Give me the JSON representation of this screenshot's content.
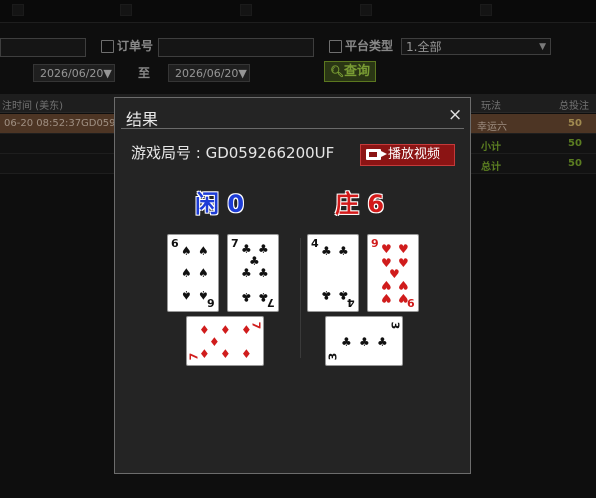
{
  "filters": {
    "order_no_label": "订单号",
    "order_no_value": "",
    "platform_label": "平台类型",
    "platform_value": "1.全部",
    "date_from": "2026/06/20▼",
    "to_label": "至",
    "date_to": "2026/06/20▼",
    "query_label": "查询"
  },
  "table": {
    "headers": {
      "bet_time": "注时间 (美东)",
      "play": "玩法",
      "total_bet": "总投注"
    },
    "rows": [
      {
        "bet_time": "06-20 08:52:37",
        "order": "GD059",
        "play": "幸运六",
        "total_bet": "50"
      },
      {
        "bet_time": "",
        "order": "",
        "play": "小计",
        "total_bet": "50"
      },
      {
        "bet_time": "",
        "order": "",
        "play": "总计",
        "total_bet": "50"
      }
    ]
  },
  "modal": {
    "title": "结果",
    "close": "×",
    "game_label": "游戏局号 : GD059266200UF",
    "video_button": "播放视频",
    "player_title": "闲 0",
    "banker_title": "庄 6",
    "player_cards": [
      {
        "rank": "6",
        "suit": "♠"
      },
      {
        "rank": "7",
        "suit": "♣"
      },
      {
        "rank": "7",
        "suit": "♦"
      }
    ],
    "banker_cards": [
      {
        "rank": "4",
        "suit": "♣"
      },
      {
        "rank": "9",
        "suit": "♥"
      },
      {
        "rank": "3",
        "suit": "♣"
      }
    ]
  },
  "colors": {
    "player": "#1d3cd6",
    "banker": "#d21a1a",
    "highlight_row": "#6b4a33",
    "query_green": "#7fae2e",
    "video_red": "#8b1414"
  }
}
